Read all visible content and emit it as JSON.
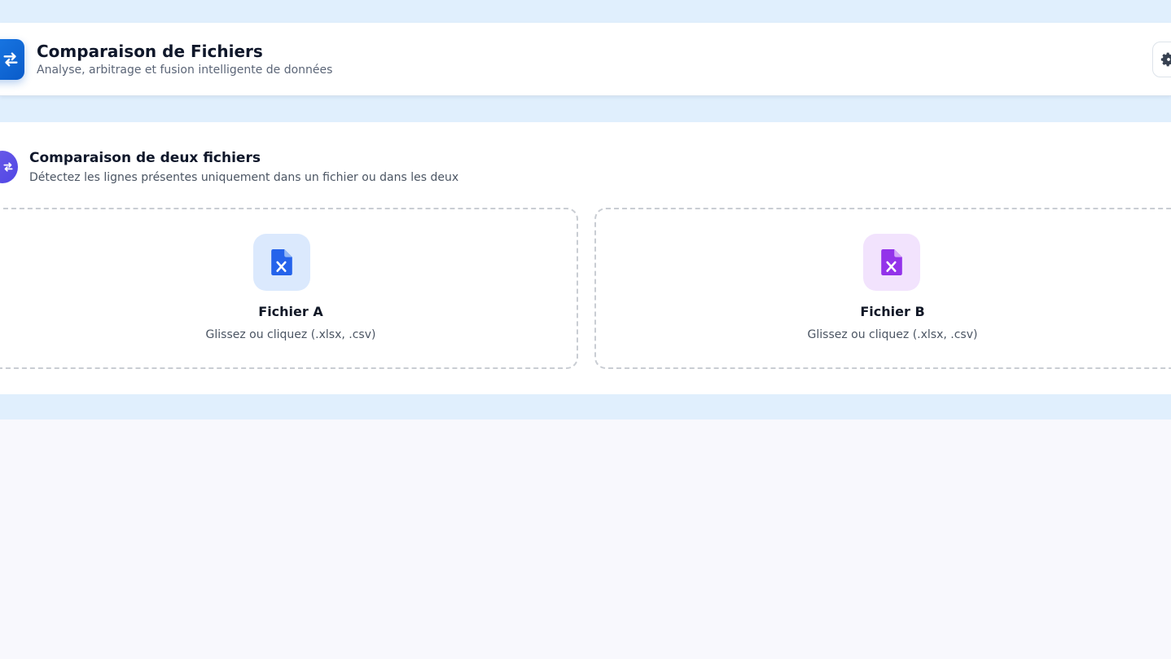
{
  "header": {
    "title": "Comparaison de Fichiers",
    "subtitle": "Analyse, arbitrage et fusion intelligente de données",
    "app_icon": "swap-arrows-icon",
    "settings_icon": "gear-icon"
  },
  "compare_card": {
    "icon": "swap-arrows-icon",
    "title": "Comparaison de deux fichiers",
    "subtitle": "Détectez les lignes présentes uniquement dans un fichier ou dans les deux"
  },
  "dropzones": [
    {
      "label": "Fichier A",
      "hint": "Glissez ou cliquez (.xlsx, .csv)",
      "icon": "excel-file-icon",
      "icon_color": "#2563eb",
      "icon_bg": "#dbe9fd"
    },
    {
      "label": "Fichier B",
      "hint": "Glissez ou cliquez (.xlsx, .csv)",
      "icon": "excel-file-icon",
      "icon_color": "#9333ea",
      "icon_bg": "#f2e3fd"
    }
  ],
  "colors": {
    "brand_blue": "#0a5bc9",
    "accent_indigo": "#4f46e5",
    "page_band": "#e0effd",
    "page_bg": "#f8f8fd"
  }
}
